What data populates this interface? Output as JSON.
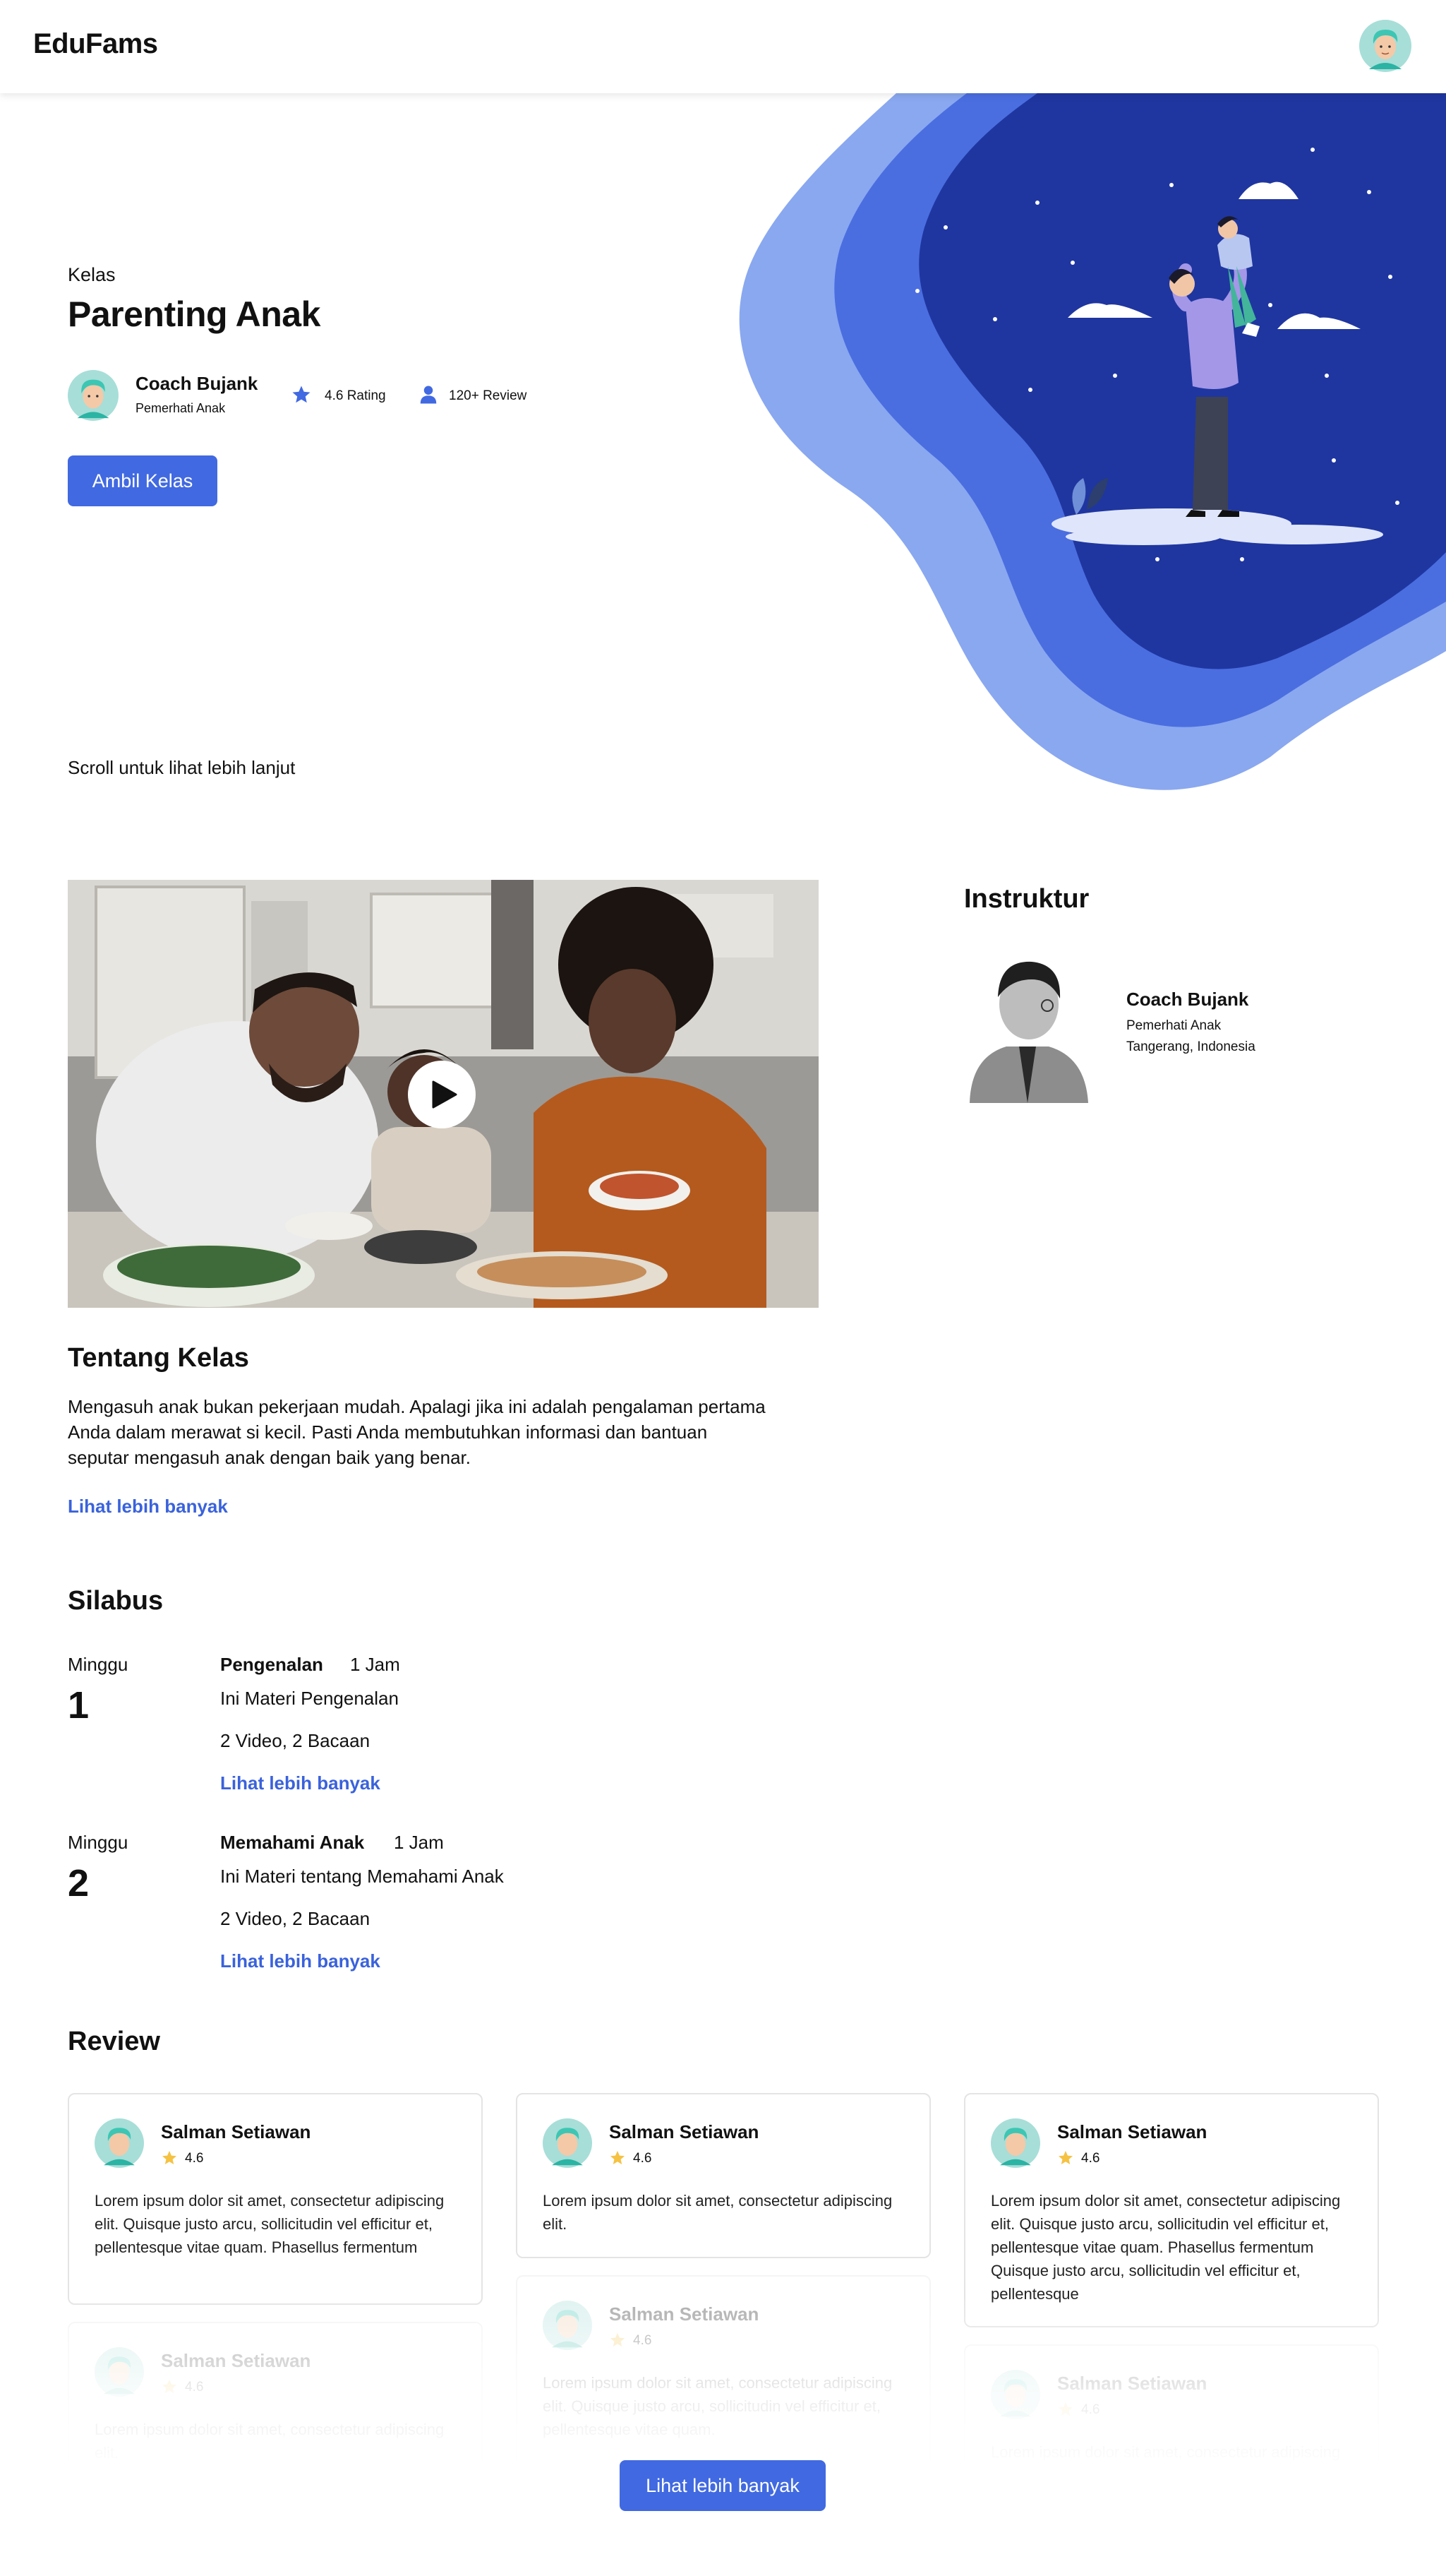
{
  "header": {
    "brand": "EduFams"
  },
  "hero": {
    "kicker": "Kelas",
    "title": "Parenting Anak",
    "coach": {
      "name": "Coach Bujank",
      "role": "Pemerhati Anak"
    },
    "rating_text": "4.6 Rating",
    "review_count_text": "120+ Review",
    "cta_label": "Ambil Kelas",
    "scroll_hint": "Scroll untuk lihat lebih lanjut"
  },
  "instructor": {
    "section_title": "Instruktur",
    "name": "Coach Bujank",
    "role": "Pemerhati Anak",
    "location": "Tangerang, Indonesia"
  },
  "about": {
    "title": "Tentang Kelas",
    "lines": [
      "Mengasuh anak bukan pekerjaan mudah. Apalagi jika ini adalah pengalaman pertama",
      "Anda dalam merawat si kecil.  Pasti Anda membutuhkan informasi dan bantuan",
      "seputar mengasuh anak dengan baik yang benar."
    ],
    "link_label": "Lihat lebih banyak"
  },
  "syllabus": {
    "title": "Silabus",
    "weeks": [
      {
        "label": "Minggu",
        "number": "1",
        "name": "Pengenalan",
        "duration": "1 Jam",
        "description": "Ini Materi Pengenalan",
        "content": "2 Video, 2 Bacaan",
        "link_label": "Lihat lebih banyak"
      },
      {
        "label": "Minggu",
        "number": "2",
        "name": "Memahami Anak",
        "duration": "1 Jam",
        "description": "Ini Materi tentang Memahami Anak",
        "content": "2 Video, 2 Bacaan",
        "link_label": "Lihat lebih banyak"
      }
    ]
  },
  "reviews": {
    "title": "Review",
    "items": [
      {
        "name": "Salman Setiawan",
        "rating": "4.6",
        "text": "Lorem ipsum dolor sit amet, consectetur adipiscing elit. Quisque justo arcu, sollicitudin vel efficitur et, pellentesque vitae quam. Phasellus fermentum"
      },
      {
        "name": "Salman Setiawan",
        "rating": "4.6",
        "text": "Lorem ipsum dolor sit amet, consectetur adipiscing elit."
      },
      {
        "name": "Salman Setiawan",
        "rating": "4.6",
        "text": "Lorem ipsum dolor sit amet, consectetur adipiscing elit. Quisque justo arcu, sollicitudin vel efficitur et, pellentesque vitae quam. Phasellus fermentum Quisque justo arcu, sollicitudin vel efficitur et, pellentesque"
      },
      {
        "name": "Salman Setiawan",
        "rating": "4.6",
        "text": "Lorem ipsum dolor sit amet, consectetur adipiscing elit."
      },
      {
        "name": "Salman Setiawan",
        "rating": "4.6",
        "text": "Lorem ipsum dolor sit amet, consectetur adipiscing elit. Quisque justo arcu, sollicitudin vel efficitur et, pellentesque vitae quam."
      },
      {
        "name": "Salman Setiawan",
        "rating": "4.6",
        "text": "Lorem ipsum dolor sit amet, consectetur adipiscing elit. Quisque justo arcu, sollicitudin vel"
      }
    ],
    "more_label": "Lihat lebih banyak"
  },
  "icons": {
    "rating": "star-icon",
    "review": "user-icon",
    "play": "play-icon",
    "card_rating": "star-icon"
  },
  "colors": {
    "accent": "#4169e1",
    "link": "#3a62db",
    "star_card": "#f5c242",
    "blob_outer": "#8aa8f0",
    "blob_mid": "#4a6ee0",
    "blob_inner": "#1f36a0"
  }
}
